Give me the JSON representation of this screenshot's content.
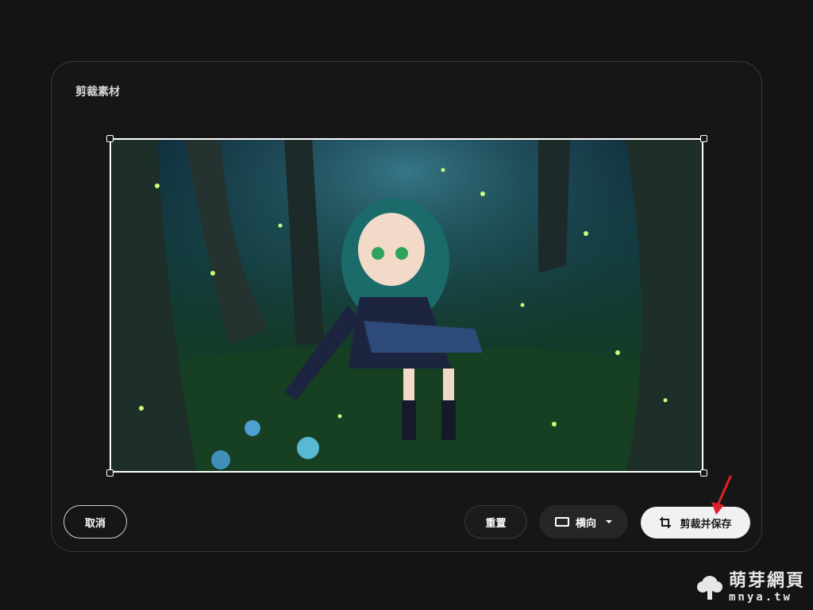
{
  "dialog": {
    "title": "剪裁素材"
  },
  "crop": {
    "image_alt": "anime girl in glowing forest",
    "handles": [
      "top-left",
      "top-right",
      "bottom-left",
      "bottom-right"
    ]
  },
  "buttons": {
    "cancel": "取消",
    "reset": "重置",
    "orientation": "横向",
    "save": "剪裁并保存"
  },
  "icons": {
    "orientation": "landscape-rect-icon",
    "dropdown": "chevron-down-icon",
    "crop": "crop-icon"
  },
  "watermark": {
    "name": "萌芽網頁",
    "url": "mnya.tw"
  },
  "colors": {
    "background": "#141414",
    "dialog": "#161616",
    "save_button": "#f1f1f1",
    "annotation_arrow": "#e0202a"
  }
}
